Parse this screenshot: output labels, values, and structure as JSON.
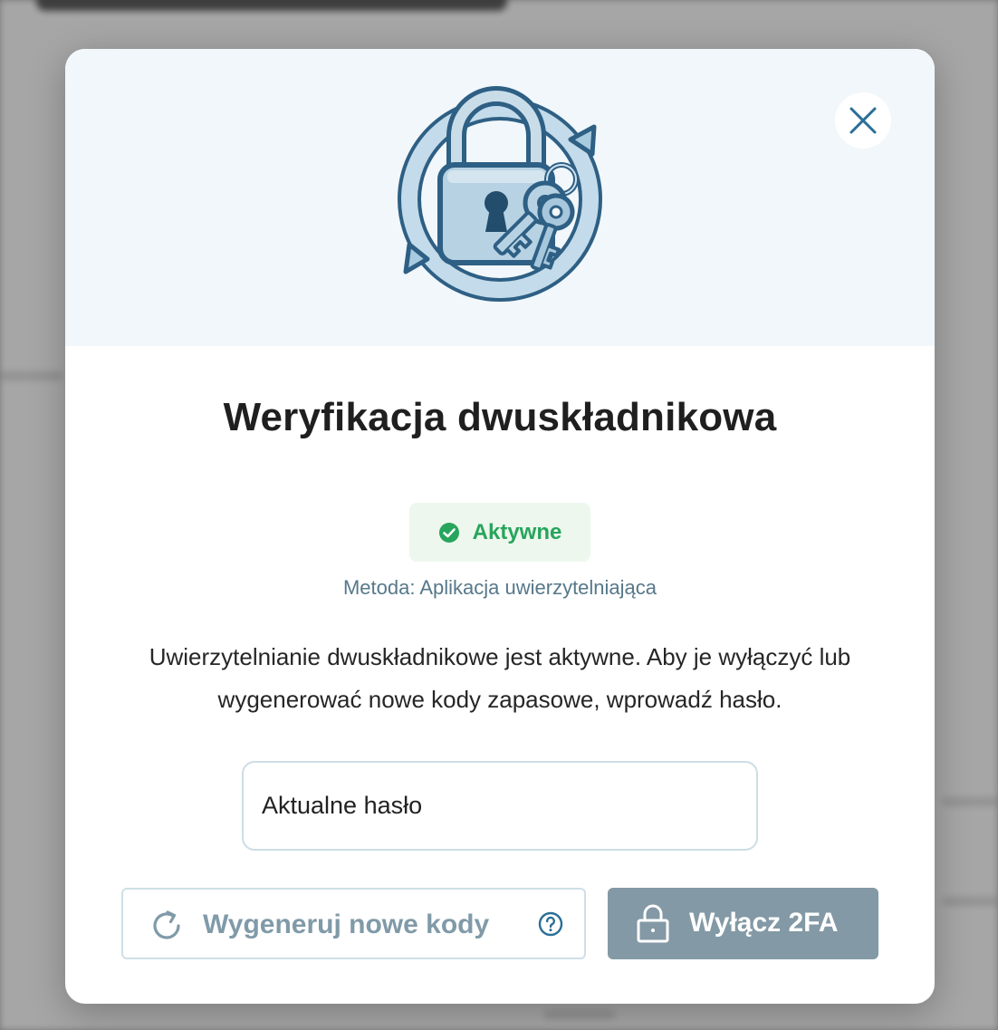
{
  "modal": {
    "title": "Weryfikacja dwuskładnikowa",
    "status": {
      "label": "Aktywne",
      "color": "#27a55c",
      "icon": "check-circle-icon"
    },
    "method_text": "Metoda: Aplikacja uwierzytelniająca",
    "description": "Uwierzytelnianie dwuskładnikowe jest aktywne. Aby je wyłączyć lub wygenerować nowe kody zapasowe, wprowadź hasło.",
    "password_field": {
      "placeholder": "Aktualne hasło",
      "value": ""
    },
    "buttons": {
      "regenerate_label": "Wygeneruj nowe kody",
      "regenerate_icon": "refresh-icon",
      "help_icon": "help-circle-icon",
      "disable_label": "Wyłącz 2FA",
      "disable_icon": "lock-icon",
      "close_icon": "close-icon"
    },
    "illustration_icon": "padlock-keys-icon"
  },
  "colors": {
    "accent": "#2a6f96",
    "hero_background": "#f1f7fa",
    "disable_button": "#8399a5"
  }
}
